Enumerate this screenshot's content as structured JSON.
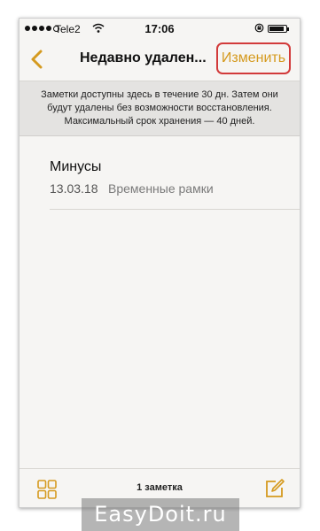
{
  "status_bar": {
    "carrier": "Tele2",
    "time": "17:06",
    "signal_bars_filled": 4,
    "signal_bars_total": 5,
    "battery_level": 0.9
  },
  "nav": {
    "back_icon": "chevron-left-icon",
    "title": "Недавно удален...",
    "edit_label": "Изменить"
  },
  "info_banner": {
    "lines": [
      "Заметки доступны здесь в течение 30 дн. Затем они",
      "будут удалены без возможности восстановления.",
      "Максимальный срок хранения — 40 дней."
    ]
  },
  "notes": [
    {
      "title": "Минусы",
      "date": "13.03.18",
      "preview": "Временные рамки"
    }
  ],
  "toolbar": {
    "grid_icon": "attachments-grid-icon",
    "count_label": "1 заметка",
    "compose_icon": "compose-icon"
  },
  "watermark": "EasyDoit.ru",
  "colors": {
    "accent": "#d59a1f",
    "highlight_box": "#d23a3a",
    "background": "#f6f5f3",
    "banner": "#e4e3e1"
  }
}
